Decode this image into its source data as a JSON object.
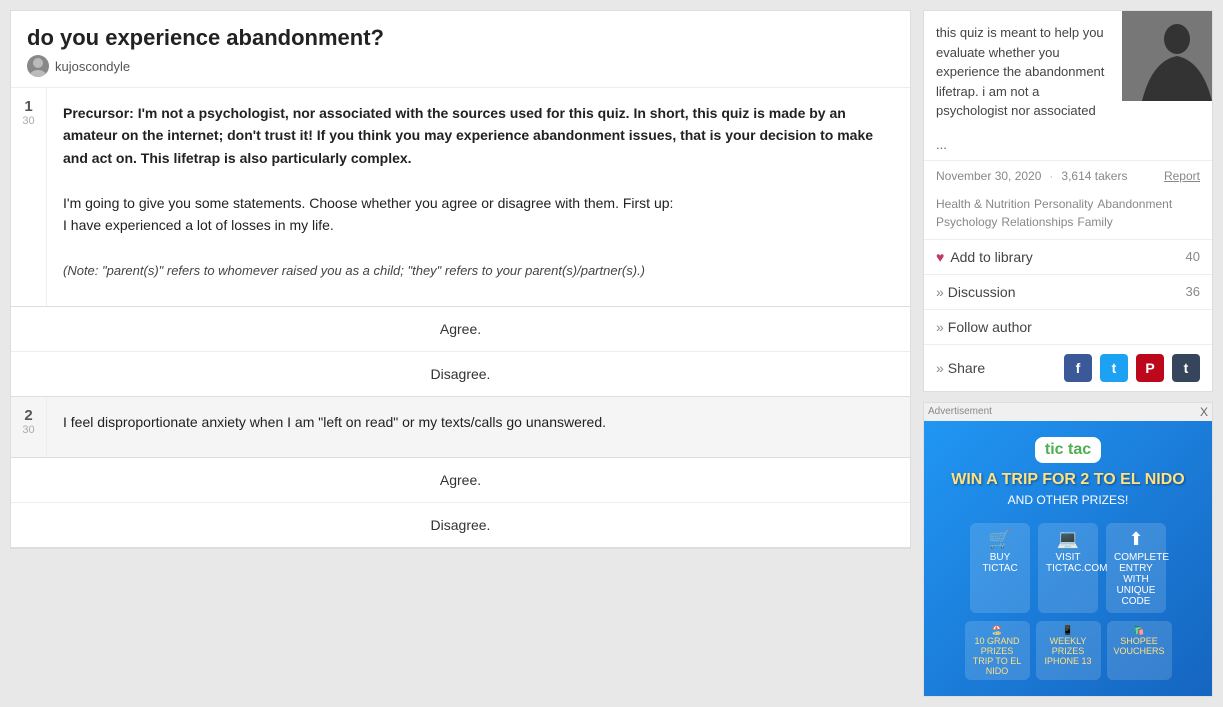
{
  "quiz": {
    "title": "do you experience abandonment?",
    "author": "kujoscondyle",
    "question1": {
      "number": "1",
      "total": "30",
      "text_part1": "Precursor: I'm not a psychologist, nor associated with the sources used for this quiz. In short, this quiz is made by an amateur on the internet; don't trust it! If you think you may experience abandonment issues, that is your decision to make and act on. This lifetrap is also particularly complex.",
      "text_part2": "I'm going to give you some statements. Choose whether you agree or disagree with them. First up:",
      "text_part3": "I have experienced a lot of losses in my life.",
      "note": "(Note: \"parent(s)\" refers to whomever raised you as a child; \"they\" refers to your parent(s)/partner(s).)",
      "agree_label": "Agree.",
      "disagree_label": "Disagree."
    },
    "question2": {
      "number": "2",
      "total": "30",
      "text": "I feel disproportionate anxiety when I am \"left on read\" or my texts/calls go unanswered.",
      "agree_label": "Agree.",
      "disagree_label": "Disagree."
    }
  },
  "sidebar": {
    "description": "this quiz is meant to help you evaluate whether you experience the abandonment lifetrap. i am not a psychologist nor associated",
    "more_label": "...",
    "date": "November 30, 2020",
    "takers": "3,614 takers",
    "report_label": "Report",
    "tags": [
      "Health & Nutrition",
      "Personality",
      "Abandonment",
      "Psychology",
      "Relationships",
      "Family"
    ],
    "add_to_library_label": "Add to library",
    "add_to_library_count": "40",
    "discussion_label": "Discussion",
    "discussion_count": "36",
    "follow_author_label": "Follow author",
    "share_label": "Share"
  },
  "ad": {
    "ad_label": "Advertisement",
    "close_label": "X",
    "logo_text": "tic tac",
    "headline": "WIN A TRIP FOR 2 TO EL NIDO",
    "subheadline": "AND OTHER PRIZES!",
    "prizes": [
      {
        "icon": "🛒",
        "label": "BUY TICTAC"
      },
      {
        "icon": "💻",
        "label": "VISIT TICTAC.COM"
      },
      {
        "icon": "⬆",
        "label": "COMPLETE ENTRY WITH UNIQUE CODE"
      }
    ],
    "grand_prizes_label": "10 GRAND PRIZES",
    "trip_label": "TRIP TO EL NIDO",
    "weekly_prizes_label": "WEEKLY PRIZES",
    "iphone_label": "IPHONE 13",
    "shopee_label": "SHOPEE VOUCHERS"
  }
}
